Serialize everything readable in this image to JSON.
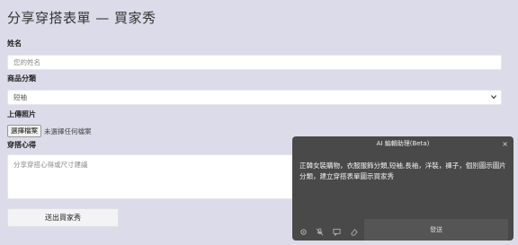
{
  "page": {
    "title": "分享穿搭表單 — 買家秀",
    "name_label": "姓名",
    "name_placeholder": "您的姓名",
    "category_label": "商品分類",
    "category_selected": "短袖",
    "photo_label": "上傳照片",
    "file_button": "選擇檔案",
    "file_status": "未選擇任何檔案",
    "review_label": "穿搭心得",
    "review_placeholder": "分享穿搭心得或尺寸建議",
    "submit_label": "送出買家秀"
  },
  "ai_panel": {
    "title": "AI 編輯助理(Beta)",
    "close_icon": "close-icon",
    "body_text": "正韓女裝購物，衣服服飾分類,短袖,長袖，洋裝，褲子，個別圖示圖片分類，建立穿搭表單圖示買家秀",
    "tools": [
      "settings-icon",
      "mic-off-icon",
      "comment-icon",
      "eraser-icon"
    ],
    "send_label": "發送"
  }
}
